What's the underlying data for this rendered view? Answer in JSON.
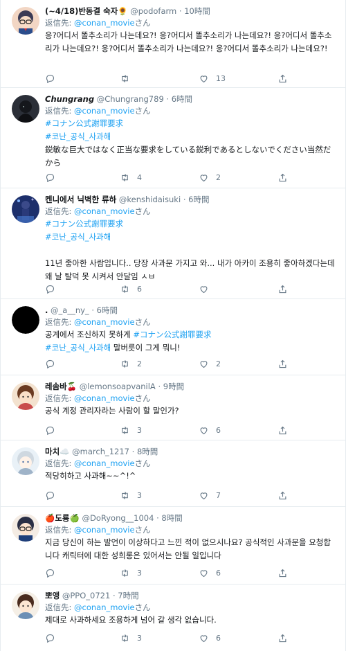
{
  "reply_prefix": "返信先:",
  "reply_suffix": "さん",
  "tweets": [
    {
      "name": "(~4/18)반동결 숙자🌻",
      "handle": "@podofarm",
      "time": "10時間",
      "reply_to": "@conan_movie",
      "text": "응?어디서 똘추소리가 나는데요?! 응?어디서 똘추소리가 나는데요?! 응?어디서 똘추소리가 나는데요?! 응?어디서 똘추소리가 나는데요?! 응?어디서 똘추소리가 나는데요?!",
      "counts": {
        "reply": "",
        "retweet": "",
        "like": "13"
      }
    },
    {
      "name": "Chungrang",
      "handle": "@Chungrang789",
      "time": "6時間",
      "reply_to": "@conan_movie",
      "tags": [
        "#コナン公式謝罪要求",
        "#코난_공식_사과해"
      ],
      "text": "鋭敏な巨大ではなく正当な要求をしている鋭利であるとしないでください当然だから",
      "counts": {
        "reply": "",
        "retweet": "4",
        "like": "2"
      }
    },
    {
      "name": "켄니에서 닉벽한 류하",
      "handle": "@kenshidaisuki",
      "time": "6時間",
      "reply_to": "@conan_movie",
      "tags": [
        "#コナン公式謝罪要求",
        "#코난_공식_사과해"
      ],
      "text": "11년 좋아한 사람입니다.. 당장 사과문 가지고 와... 내가 아카이 조용히 좋아하겠다는데 왜 날 탈덕 못 시켜서 안달임 ㅅㅂ",
      "counts": {
        "reply": "",
        "retweet": "6",
        "like": ""
      }
    },
    {
      "name": ".",
      "handle": "@_a__ny_",
      "time": "6時間",
      "reply_to": "@conan_movie",
      "text_before": "공계에서 조신하지 못하게",
      "tag1": "#コナン公式謝罪要求",
      "tag2": "#코난_공식_사과해",
      "text_after": "말버릇이 그게 뭐니!",
      "counts": {
        "reply": "",
        "retweet": "2",
        "like": "2"
      }
    },
    {
      "name": "레솜바🍒",
      "handle": "@lemonsoapvanilA",
      "time": "9時間",
      "reply_to": "@conan_movie",
      "text": "공식 계정 관리자라는 사람이 할 말인가?",
      "counts": {
        "reply": "",
        "retweet": "3",
        "like": "6"
      }
    },
    {
      "name": "마치☁️",
      "handle": "@march_1217",
      "time": "8時間",
      "reply_to": "@conan_movie",
      "text": "적당히하고 사과해~~^!^",
      "counts": {
        "reply": "",
        "retweet": "3",
        "like": "7"
      }
    },
    {
      "name": "🍎도룡🍏",
      "handle": "@DoRyong__1004",
      "time": "8時間",
      "reply_to": "@conan_movie",
      "text": "지금 당신이 하는 발언이 이상하다고 느낀 적이 없으시나요? 공식적인 사과문을 요청합니다 캐릭터에 대한 성희롱은 있어서는 안될 일입니다",
      "counts": {
        "reply": "",
        "retweet": "3",
        "like": "6"
      }
    },
    {
      "name": "뽀앵",
      "handle": "@PPO_0721",
      "time": "7時間",
      "reply_to": "@conan_movie",
      "text": "제대로 사과하세요 조용하게 넘어 갈 생각 없습니다.",
      "counts": {
        "reply": "",
        "retweet": "3",
        "like": "6"
      }
    }
  ],
  "colors": {
    "link": "#1da1f2",
    "muted": "#657786",
    "border": "#e6ecf0"
  },
  "icons": [
    "reply-icon",
    "retweet-icon",
    "like-icon",
    "share-icon"
  ]
}
